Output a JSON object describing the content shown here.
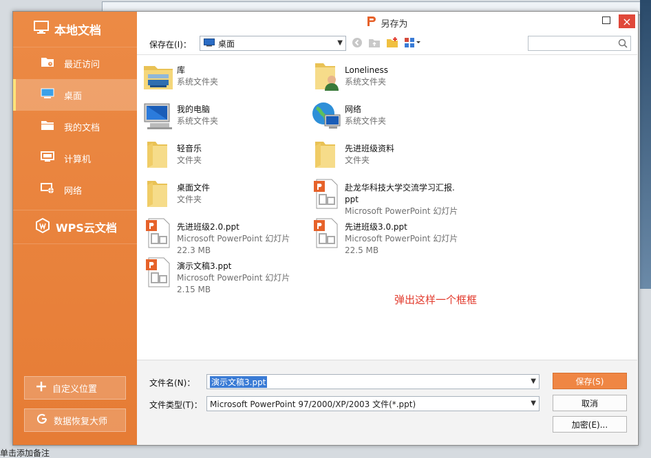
{
  "dialog": {
    "title": "另存为",
    "close_glyph": "×"
  },
  "sidebar": {
    "header": "本地文档",
    "items": [
      {
        "label": "最近访问",
        "icon": "recent-folder-icon"
      },
      {
        "label": "桌面",
        "icon": "desktop-icon",
        "active": true
      },
      {
        "label": "我的文档",
        "icon": "documents-folder-icon"
      },
      {
        "label": "计算机",
        "icon": "computer-icon"
      },
      {
        "label": "网络",
        "icon": "network-icon"
      }
    ],
    "cloud": "WPS云文档",
    "custom_location": "自定义位置",
    "data_recovery": "数据恢复大师"
  },
  "toolbar": {
    "save_in_label": "保存在(I)：",
    "location": "桌面"
  },
  "files": [
    {
      "name": "库",
      "sub": [
        "系统文件夹"
      ],
      "icon": "library-icon"
    },
    {
      "name": "Loneliness",
      "sub": [
        "系统文件夹"
      ],
      "icon": "user-folder-icon"
    },
    {
      "name": "我的电脑",
      "sub": [
        "系统文件夹"
      ],
      "icon": "computer-icon"
    },
    {
      "name": "网络",
      "sub": [
        "系统文件夹"
      ],
      "icon": "network-globe-icon"
    },
    {
      "name": "轻音乐",
      "sub": [
        "文件夹"
      ],
      "icon": "folder-icon"
    },
    {
      "name": "先进班级资料",
      "sub": [
        "文件夹"
      ],
      "icon": "folder-icon"
    },
    {
      "name": "桌面文件",
      "sub": [
        "文件夹"
      ],
      "icon": "folder-icon"
    },
    {
      "name": "赴龙华科技大学交流学习汇报.",
      "name2": "ppt",
      "sub": [
        "Microsoft PowerPoint 幻灯片"
      ],
      "icon": "ppt-file-icon"
    },
    {
      "name": "先进班级2.0.ppt",
      "sub": [
        "Microsoft PowerPoint 幻灯片",
        "22.3 MB"
      ],
      "icon": "ppt-file-icon"
    },
    {
      "name": "先进班级3.0.ppt",
      "sub": [
        "Microsoft PowerPoint 幻灯片",
        "22.5 MB"
      ],
      "icon": "ppt-file-icon"
    },
    {
      "name": "演示文稿3.ppt",
      "sub": [
        "Microsoft PowerPoint 幻灯片",
        "2.15 MB"
      ],
      "icon": "ppt-file-icon"
    }
  ],
  "annotation": "弹出这样一个框框",
  "bottom": {
    "filename_label": "文件名(N)：",
    "filename_value": "演示文稿3.ppt",
    "filetype_label": "文件类型(T)：",
    "filetype_value": "Microsoft PowerPoint 97/2000/XP/2003 文件(*.ppt)",
    "save_button": "保存(S)",
    "cancel_button": "取消",
    "encrypt_button": "加密(E)..."
  },
  "background": {
    "bottom_text": "单击添加备注"
  },
  "colors": {
    "accent": "#e67c35",
    "close": "#e0483a",
    "annotation": "#e23a2c"
  }
}
